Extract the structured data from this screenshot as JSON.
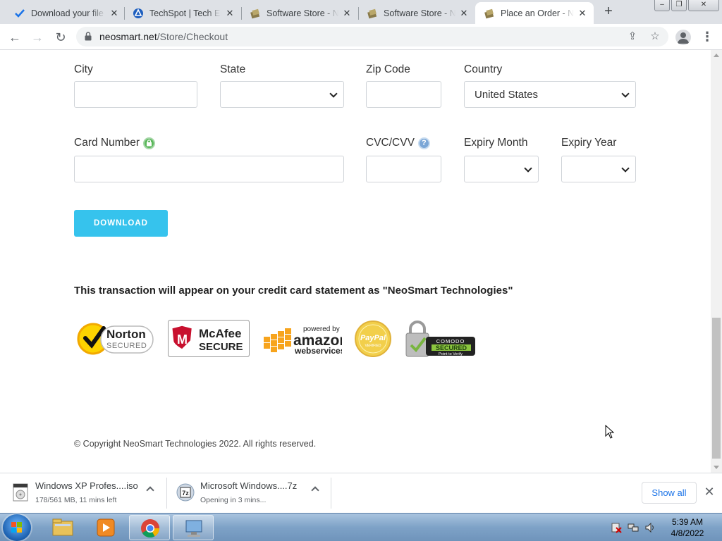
{
  "browser": {
    "tabs": [
      {
        "title": "Download your file",
        "favicon": "checkmark-icon"
      },
      {
        "title": "TechSpot | Tech Ent",
        "favicon": "techspot-icon"
      },
      {
        "title": "Software Store - Ne",
        "favicon": "neosmart-icon"
      },
      {
        "title": "Software Store - Ne",
        "favicon": "neosmart-icon"
      },
      {
        "title": "Place an Order - Ne",
        "favicon": "neosmart-icon",
        "active": true
      }
    ],
    "url_host": "neosmart.net",
    "url_path": "/Store/Checkout"
  },
  "form": {
    "city_label": "City",
    "state_label": "State",
    "zip_label": "Zip Code",
    "country_label": "Country",
    "country_value": "United States",
    "card_label": "Card Number",
    "cvc_label": "CVC/CVV",
    "cvc_help": "?",
    "expiry_month_label": "Expiry Month",
    "expiry_year_label": "Expiry Year",
    "download_button": "DOWNLOAD"
  },
  "notice": "This transaction will appear on your credit card statement as \"NeoSmart Technologies\"",
  "seals": {
    "norton_top": "Norton",
    "norton_bottom": "SECURED",
    "mcafee_top": "McAfee",
    "mcafee_bottom": "SECURE",
    "aws_small": "powered by",
    "aws_big": "amazon",
    "aws_sub": "webservices",
    "paypal_main": "PayPal",
    "paypal_sub": "VERIFIED",
    "comodo_top": "COMODO",
    "comodo_mid": "SECURED",
    "comodo_bottom": "Point to Verify"
  },
  "copyright": "© Copyright NeoSmart Technologies 2022. All rights reserved.",
  "downloads": [
    {
      "name": "Windows XP Profes....iso",
      "status": "178/561 MB, 11 mins left"
    },
    {
      "name": "Microsoft Windows....7z",
      "status": "Opening in 3 mins..."
    }
  ],
  "shelf": {
    "show_all": "Show all"
  },
  "taskbar": {
    "time": "5:39 AM",
    "date": "4/8/2022"
  },
  "colors": {
    "accent_button": "#36c3ed",
    "lock_green": "#5cb85c",
    "help_blue": "#7ba7d7"
  }
}
